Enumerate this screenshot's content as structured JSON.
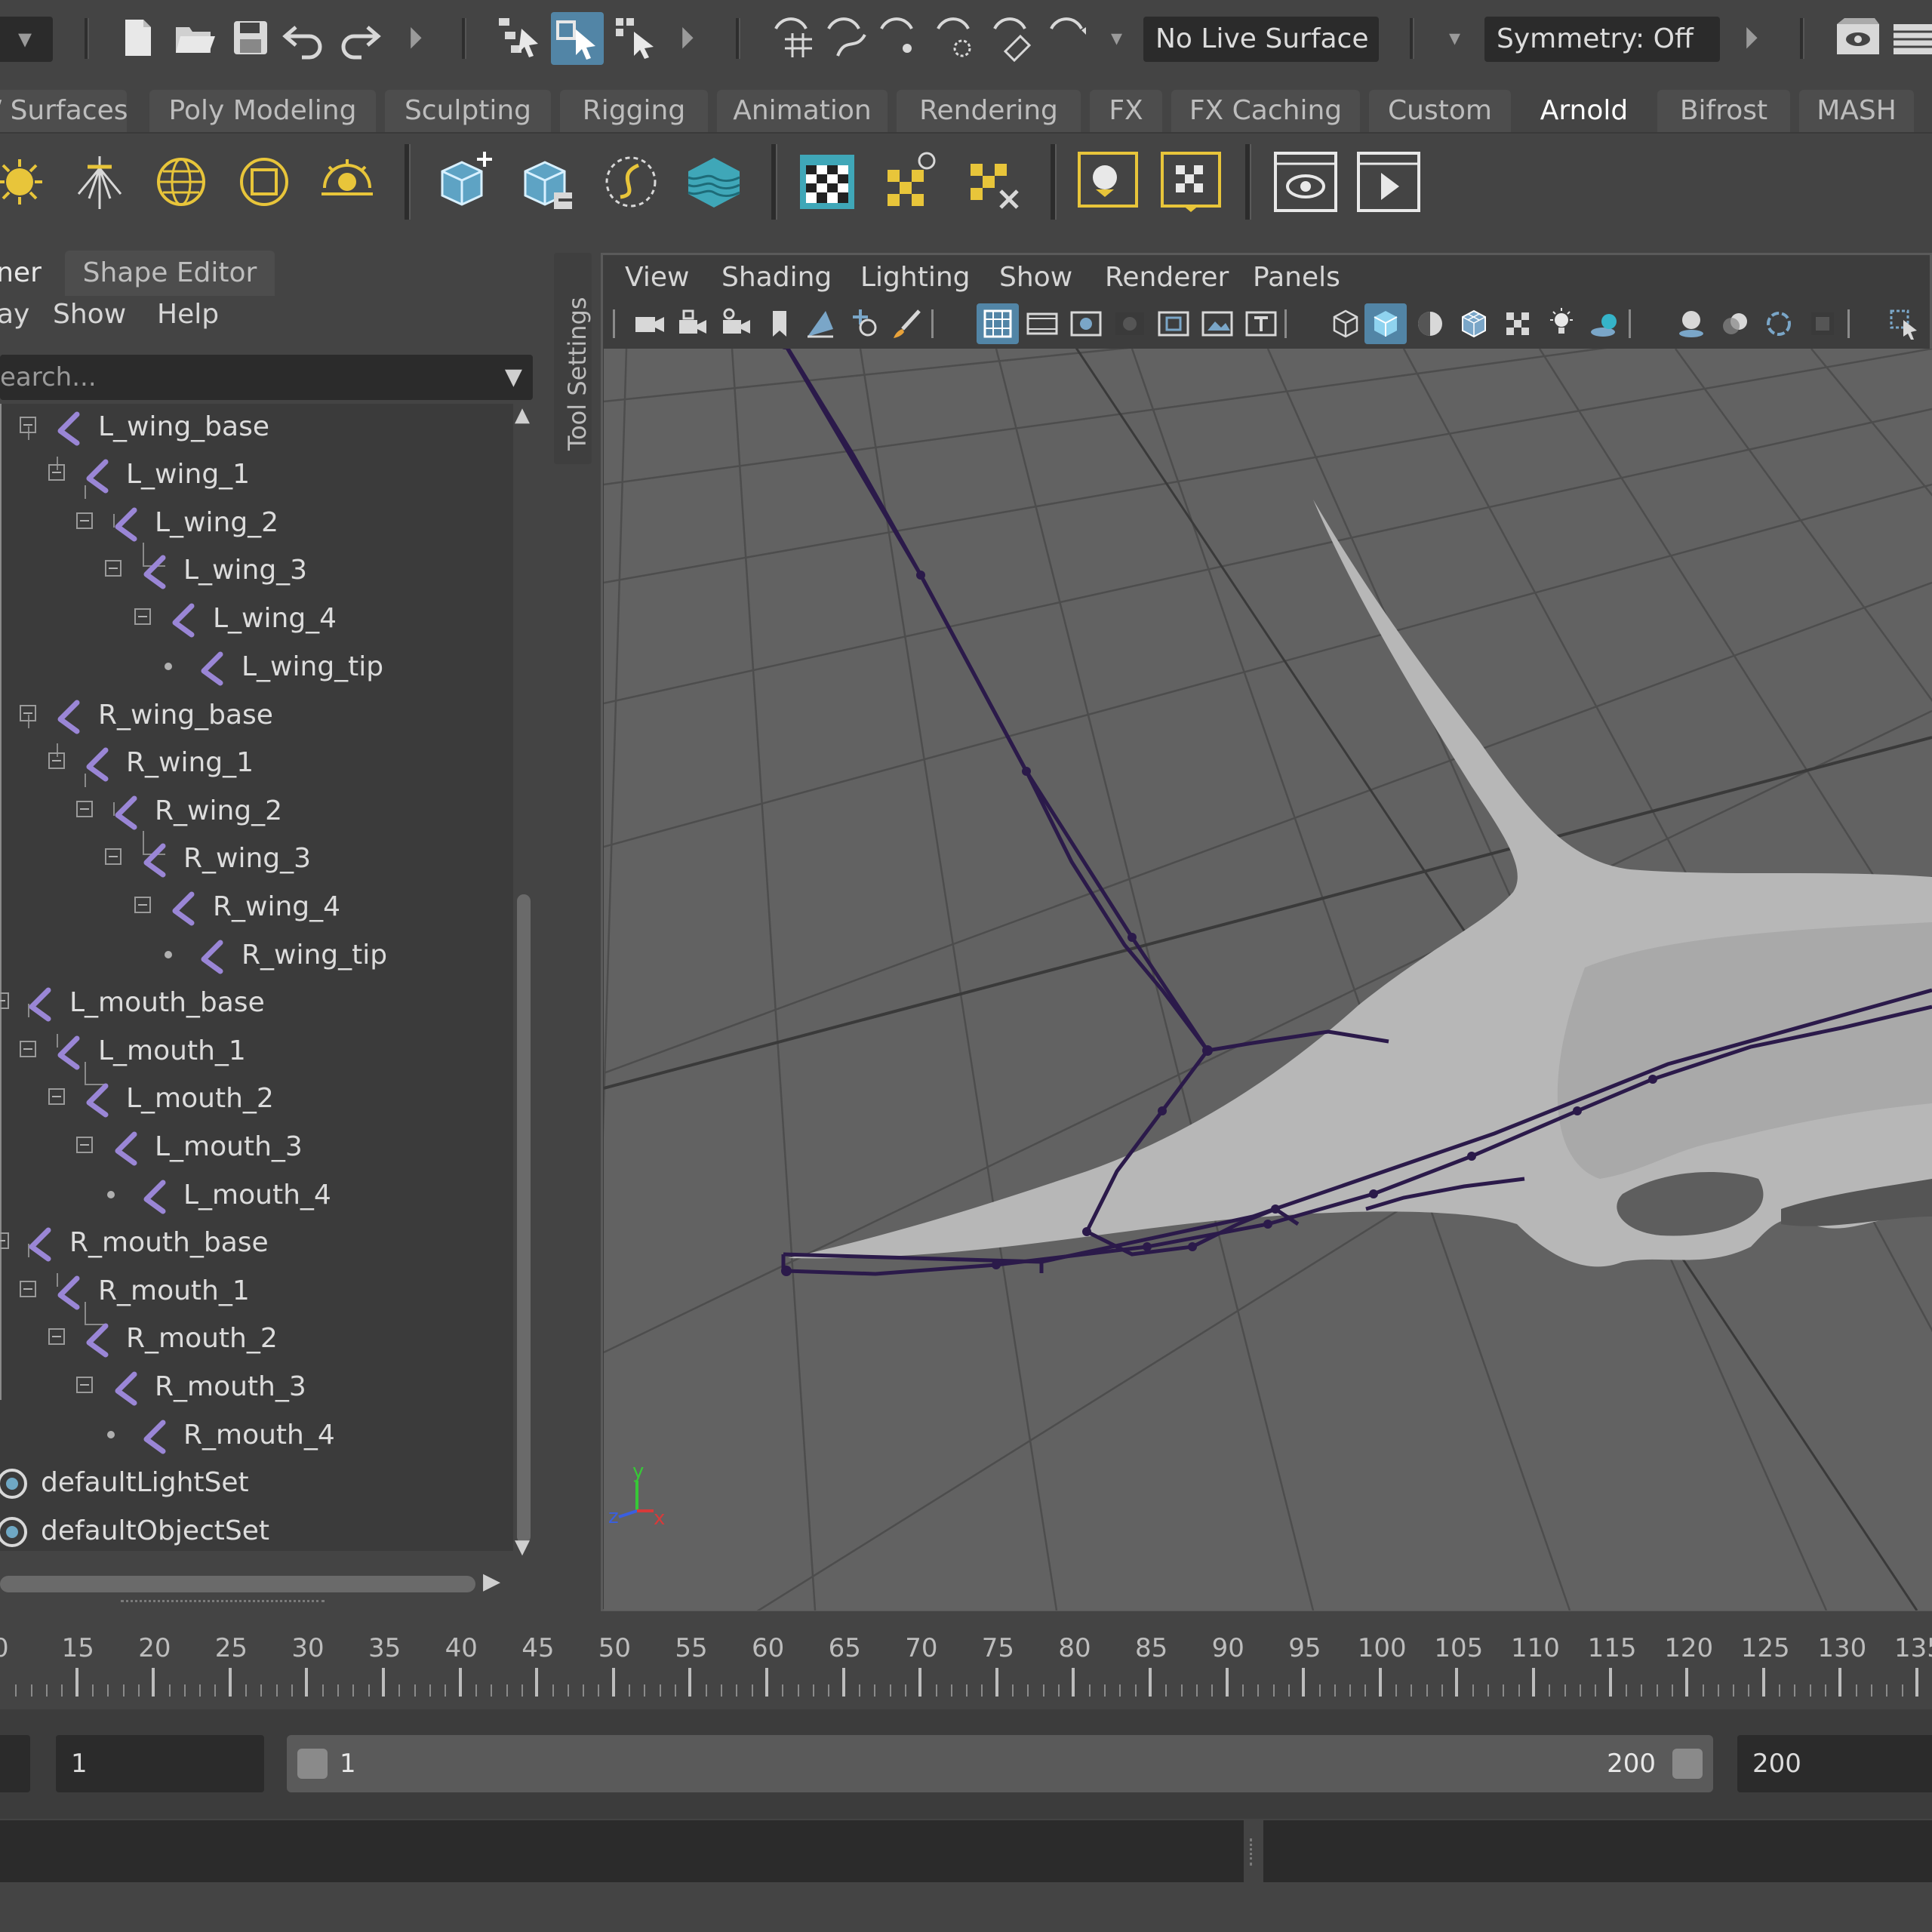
{
  "status_line": {
    "live_surface": "No Live Surface",
    "symmetry": "Symmetry: Off"
  },
  "shelf_tabs": [
    {
      "label": "/ Surfaces",
      "active": false
    },
    {
      "label": "Poly Modeling",
      "active": false
    },
    {
      "label": "Sculpting",
      "active": false
    },
    {
      "label": "Rigging",
      "active": false
    },
    {
      "label": "Animation",
      "active": false
    },
    {
      "label": "Rendering",
      "active": false
    },
    {
      "label": "FX",
      "active": false
    },
    {
      "label": "FX Caching",
      "active": false
    },
    {
      "label": "Custom",
      "active": false
    },
    {
      "label": "Arnold",
      "active": true
    },
    {
      "label": "Bifrost",
      "active": false
    },
    {
      "label": "MASH",
      "active": false
    }
  ],
  "outliner": {
    "tab_title": "ner",
    "tab_shape_editor": "Shape Editor",
    "menu": [
      "ay",
      "Show",
      "Help"
    ],
    "search_placeholder": "earch...",
    "items": [
      {
        "label": "L_wing_base",
        "type": "joint"
      },
      {
        "label": "L_wing_1",
        "type": "joint"
      },
      {
        "label": "L_wing_2",
        "type": "joint"
      },
      {
        "label": "L_wing_3",
        "type": "joint"
      },
      {
        "label": "L_wing_4",
        "type": "joint"
      },
      {
        "label": "L_wing_tip",
        "type": "joint"
      },
      {
        "label": "R_wing_base",
        "type": "joint"
      },
      {
        "label": "R_wing_1",
        "type": "joint"
      },
      {
        "label": "R_wing_2",
        "type": "joint"
      },
      {
        "label": "R_wing_3",
        "type": "joint"
      },
      {
        "label": "R_wing_4",
        "type": "joint"
      },
      {
        "label": "R_wing_tip",
        "type": "joint"
      },
      {
        "label": "L_mouth_base",
        "type": "joint"
      },
      {
        "label": "L_mouth_1",
        "type": "joint"
      },
      {
        "label": "L_mouth_2",
        "type": "joint"
      },
      {
        "label": "L_mouth_3",
        "type": "joint"
      },
      {
        "label": "L_mouth_4",
        "type": "joint"
      },
      {
        "label": "R_mouth_base",
        "type": "joint"
      },
      {
        "label": "R_mouth_1",
        "type": "joint"
      },
      {
        "label": "R_mouth_2",
        "type": "joint"
      },
      {
        "label": "R_mouth_3",
        "type": "joint"
      },
      {
        "label": "R_mouth_4",
        "type": "joint"
      },
      {
        "label": "defaultLightSet",
        "type": "set"
      },
      {
        "label": "defaultObjectSet",
        "type": "set"
      }
    ]
  },
  "tool_settings_label": "Tool Settings",
  "viewport": {
    "menu": [
      "View",
      "Shading",
      "Lighting",
      "Show",
      "Renderer",
      "Panels"
    ],
    "axis": {
      "y": "y",
      "z": "z",
      "x": "x"
    }
  },
  "time_slider": {
    "labels": [
      "0",
      "15",
      "20",
      "25",
      "30",
      "35",
      "40",
      "45",
      "50",
      "55",
      "60",
      "65",
      "70",
      "75",
      "80",
      "85",
      "90",
      "95",
      "100",
      "105",
      "110",
      "115",
      "120",
      "125",
      "130",
      "135"
    ]
  },
  "range_slider": {
    "start_field": "1",
    "range_start": "1",
    "range_end": "200",
    "end_field": "200"
  },
  "colors": {
    "accent": "#5285a6",
    "joint": "#9a86d6",
    "skeleton": "#2b1a4a",
    "mesh": "#b9b9b9"
  }
}
